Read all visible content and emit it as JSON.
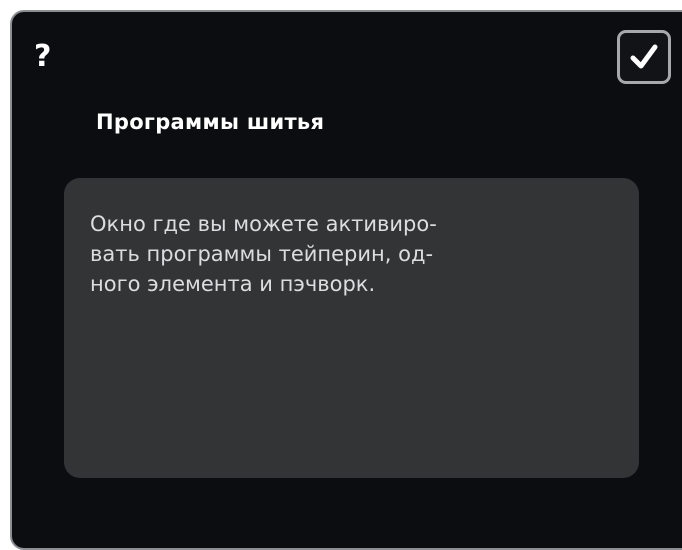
{
  "dialog": {
    "help_label": "?",
    "confirm_icon": "checkmark-icon",
    "title": "Программы шитья",
    "description": "Окно где вы можете активиро-\nвать программы тейперин, од-\nного элемента и пэчворк."
  }
}
